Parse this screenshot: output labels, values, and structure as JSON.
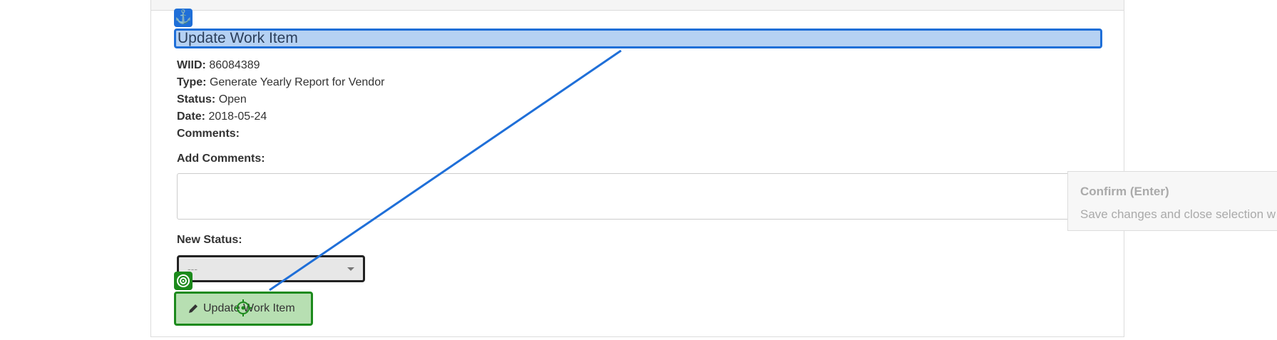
{
  "form": {
    "title": "Update Work Item",
    "fields": [
      {
        "label": "WIID:",
        "value": "86084389"
      },
      {
        "label": "Type:",
        "value": "Generate Yearly Report for Vendor"
      },
      {
        "label": "Status:",
        "value": "Open"
      },
      {
        "label": "Date:",
        "value": "2018-05-24"
      },
      {
        "label": "Comments:",
        "value": ""
      }
    ],
    "add_comments_label": "Add Comments:",
    "add_comments_value": "",
    "new_status_label": "New Status:",
    "new_status_selected": "---",
    "submit_label": "Update Work Item"
  },
  "tooltip": {
    "title": "Confirm (Enter)",
    "text": "Save changes and close selection w"
  },
  "icons": {
    "anchor": "anchor-icon",
    "target": "target-icon",
    "pencil": "pencil-icon",
    "crosshair": "crosshair-icon"
  },
  "colors": {
    "anchor_highlight": "#1f6fd8",
    "target_highlight": "#1c8a1c"
  }
}
